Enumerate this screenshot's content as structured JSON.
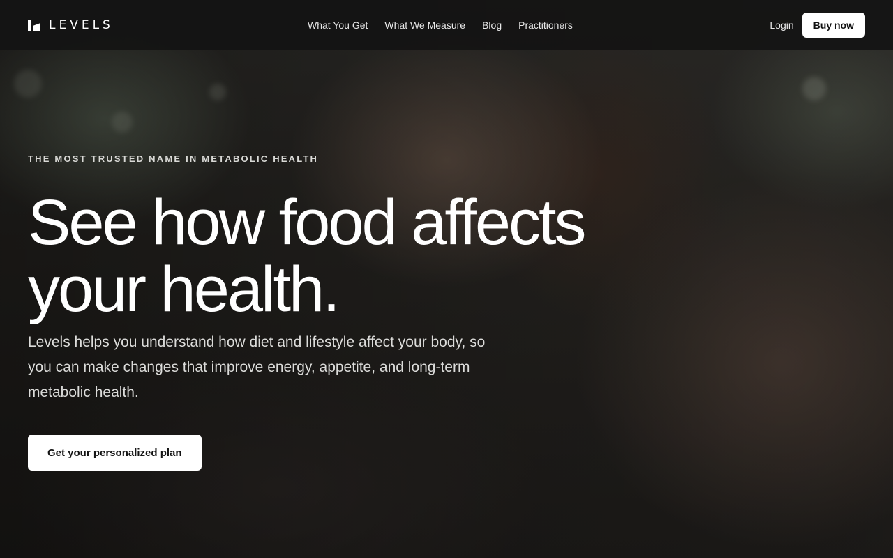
{
  "header": {
    "brand": "LEVELS",
    "nav": [
      {
        "label": "What You Get"
      },
      {
        "label": "What We Measure"
      },
      {
        "label": "Blog"
      },
      {
        "label": "Practitioners"
      }
    ],
    "login_label": "Login",
    "buy_label": "Buy now"
  },
  "hero": {
    "eyebrow": "THE MOST TRUSTED NAME IN METABOLIC HEALTH",
    "headline_line1": "See how food affects",
    "headline_line2": "your health.",
    "subhead": "Levels helps you understand how diet and lifestyle affect your body, so you can make changes that improve energy, appetite, and long-term metabolic health.",
    "cta_label": "Get your personalized plan"
  },
  "colors": {
    "header_bg": "#141414",
    "button_bg": "#ffffff",
    "button_text": "#141414",
    "text_primary": "#ffffff"
  }
}
